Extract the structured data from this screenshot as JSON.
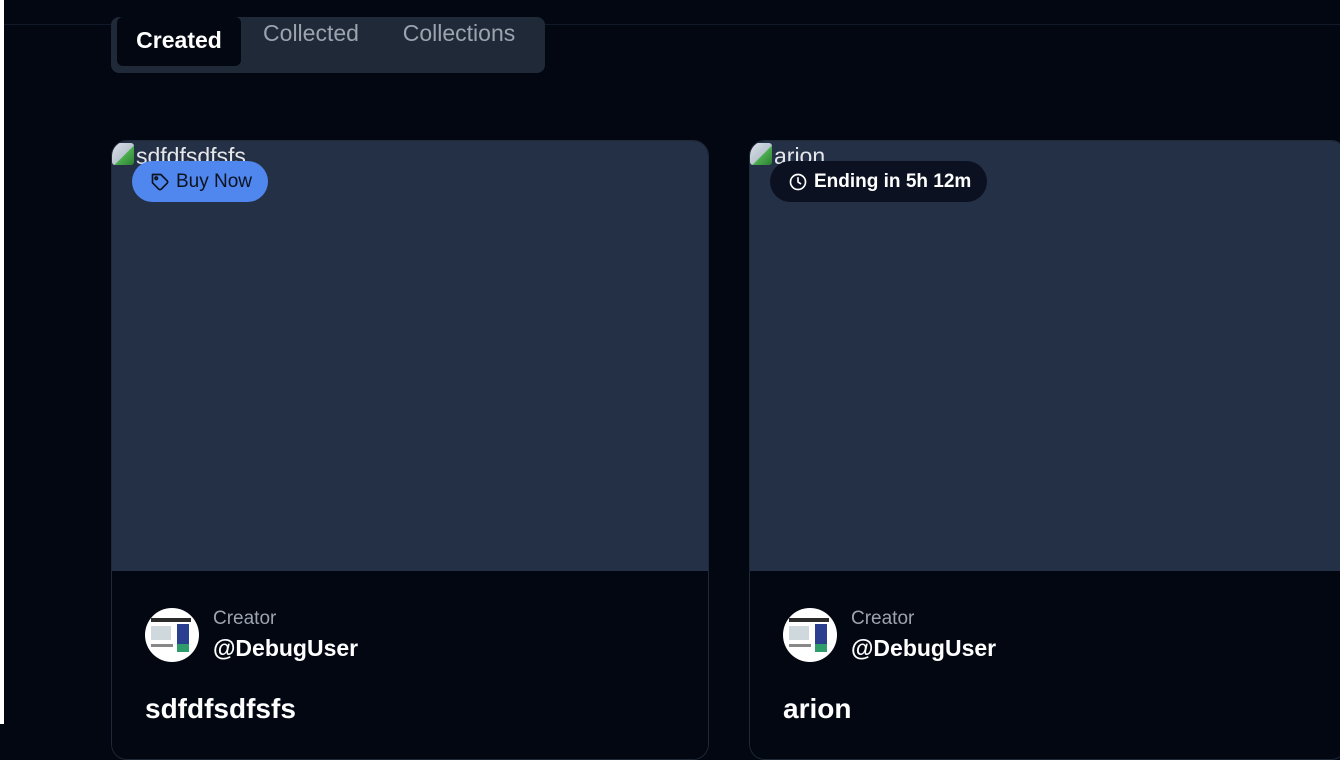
{
  "tabs": [
    {
      "label": "Created",
      "active": true
    },
    {
      "label": "Collected",
      "active": false
    },
    {
      "label": "Collections",
      "active": false
    }
  ],
  "cards": [
    {
      "image_alt": "sdfdfsdfsfs",
      "badge": {
        "label": "Buy Now",
        "icon": "tag-icon",
        "color": "#4f87ee"
      },
      "creator_label": "Creator",
      "creator_handle": "@DebugUser",
      "title": "sdfdfsdfsfs"
    },
    {
      "image_alt": "arion",
      "badge": {
        "label": "Ending in 5h 12m",
        "icon": "clock-icon",
        "color": "#0b1120"
      },
      "creator_label": "Creator",
      "creator_handle": "@DebugUser",
      "title": "arion"
    }
  ]
}
